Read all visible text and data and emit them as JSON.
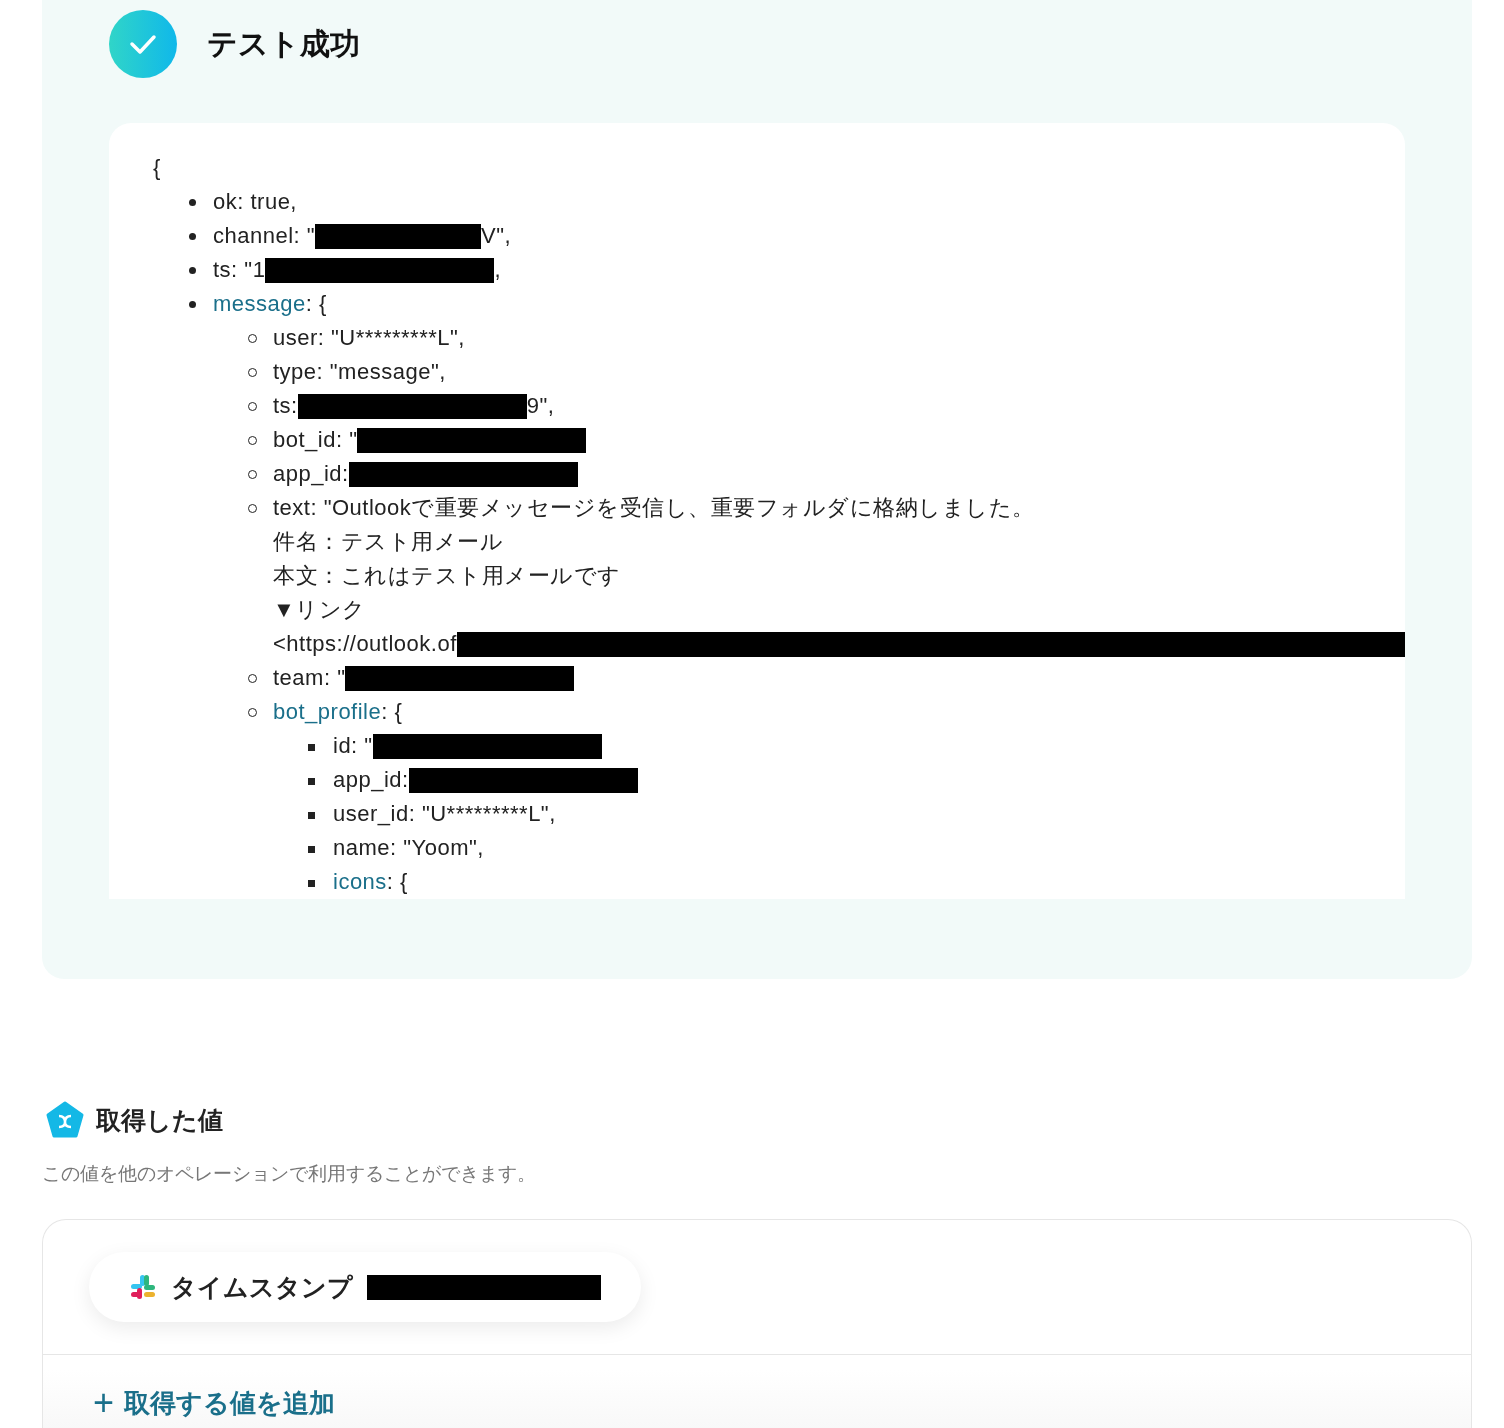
{
  "result": {
    "title": "テスト成功",
    "code": {
      "open": "{",
      "items": [
        {
          "lines": [
            [
              {
                "kind": "text",
                "text": "ok: true,"
              }
            ]
          ]
        },
        {
          "lines": [
            [
              {
                "kind": "text",
                "text": "channel: \""
              },
              {
                "kind": "redacted_short"
              },
              {
                "kind": "text",
                "text": "V\","
              }
            ]
          ]
        },
        {
          "lines": [
            [
              {
                "kind": "text",
                "text": "ts: \"1"
              },
              {
                "kind": "redacted"
              },
              {
                "kind": "text",
                "text": ","
              }
            ]
          ]
        },
        {
          "lines": [
            [
              {
                "kind": "key",
                "text": "message"
              },
              {
                "kind": "text",
                "text": ": {"
              }
            ]
          ],
          "children": [
            {
              "lines": [
                [
                  {
                    "kind": "text",
                    "text": "user: \"U*********L\","
                  }
                ]
              ]
            },
            {
              "lines": [
                [
                  {
                    "kind": "text",
                    "text": "type: \"message\","
                  }
                ]
              ]
            },
            {
              "lines": [
                [
                  {
                    "kind": "text",
                    "text": "ts: "
                  },
                  {
                    "kind": "redacted"
                  },
                  {
                    "kind": "text",
                    "text": "9\","
                  }
                ]
              ]
            },
            {
              "lines": [
                [
                  {
                    "kind": "text",
                    "text": "bot_id: \""
                  },
                  {
                    "kind": "redacted"
                  }
                ]
              ]
            },
            {
              "lines": [
                [
                  {
                    "kind": "text",
                    "text": "app_id: "
                  },
                  {
                    "kind": "redacted"
                  }
                ]
              ]
            },
            {
              "lines": [
                [
                  {
                    "kind": "text",
                    "text": "text: \"Outlookで重要メッセージを受信し、重要フォルダに格納しました。"
                  }
                ],
                [
                  {
                    "kind": "text",
                    "text": "件名：テスト用メール"
                  }
                ],
                [
                  {
                    "kind": "text",
                    "text": "本文：これはテスト用メールです"
                  }
                ],
                [
                  {
                    "kind": "text",
                    "text": "▼リンク"
                  }
                ],
                [
                  {
                    "kind": "text",
                    "text": "<https://outlook.of"
                  },
                  {
                    "kind": "redacted_to_edge"
                  }
                ]
              ]
            },
            {
              "lines": [
                [
                  {
                    "kind": "text",
                    "text": "team: \""
                  },
                  {
                    "kind": "redacted"
                  }
                ]
              ]
            },
            {
              "lines": [
                [
                  {
                    "kind": "key",
                    "text": "bot_profile"
                  },
                  {
                    "kind": "text",
                    "text": ": {"
                  }
                ]
              ],
              "children": [
                {
                  "lines": [
                    [
                      {
                        "kind": "text",
                        "text": "id: \""
                      },
                      {
                        "kind": "redacted"
                      }
                    ]
                  ]
                },
                {
                  "lines": [
                    [
                      {
                        "kind": "text",
                        "text": "app_id: "
                      },
                      {
                        "kind": "redacted"
                      }
                    ]
                  ]
                },
                {
                  "lines": [
                    [
                      {
                        "kind": "text",
                        "text": "user_id: \"U*********L\","
                      }
                    ]
                  ]
                },
                {
                  "lines": [
                    [
                      {
                        "kind": "text",
                        "text": "name: \"Yoom\","
                      }
                    ]
                  ]
                },
                {
                  "lines": [
                    [
                      {
                        "kind": "key",
                        "text": "icons"
                      },
                      {
                        "kind": "text",
                        "text": ": {"
                      }
                    ]
                  ]
                }
              ]
            }
          ]
        }
      ]
    }
  },
  "values": {
    "title": "取得した値",
    "description": "この値を他のオペレーションで利用することができます。",
    "chips": [
      {
        "label": "タイムスタンプ",
        "redacted": true
      }
    ],
    "add_button": {
      "icon": "+",
      "label": "取得する値を追加"
    }
  }
}
